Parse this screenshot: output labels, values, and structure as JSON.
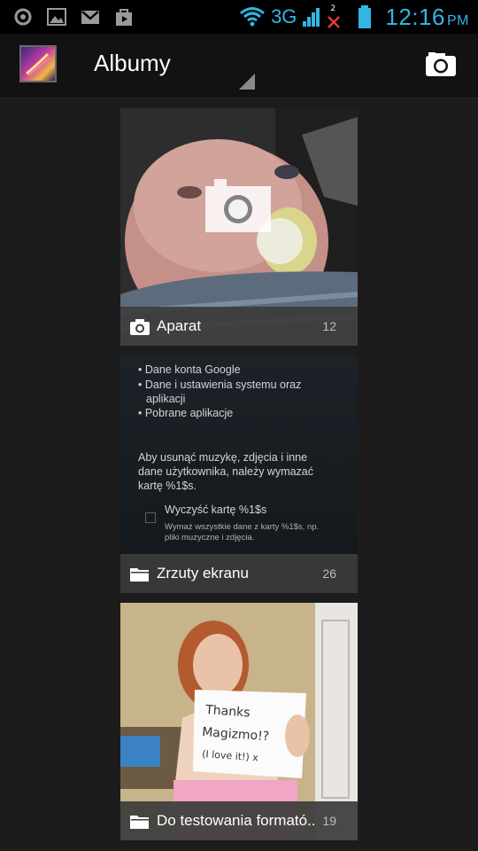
{
  "status_bar": {
    "network": "3G",
    "sim_slot": "2",
    "time": "12:16",
    "ampm": "PM",
    "accent_color": "#33b5e5"
  },
  "action_bar": {
    "title": "Albumy",
    "app_icon": "gallery-icon",
    "camera_button": "camera-icon"
  },
  "albums": [
    {
      "name": "Aparat",
      "count": "12",
      "type_icon": "camera-icon"
    },
    {
      "name": "Zrzuty ekranu",
      "count": "26",
      "type_icon": "folder-icon",
      "preview_lines": [
        "• Dane konta Google",
        "• Dane i ustawienia systemu oraz",
        "aplikacji",
        "• Pobrane aplikacje",
        "Aby usunąć muzykę, zdjęcia i inne",
        "dane użytkownika, należy wymazać",
        "kartę %1$s.",
        "Wyczyść kartę %1$s",
        "Wymaż wszystkie dane z karty %1$s, np.",
        "pliki muzyczne i zdjęcia."
      ]
    },
    {
      "name": "Do testowania formató..",
      "count": "19",
      "type_icon": "folder-icon",
      "sign_lines": [
        "Thanks",
        "Magizmo!?",
        "(I love it!) x"
      ]
    }
  ]
}
